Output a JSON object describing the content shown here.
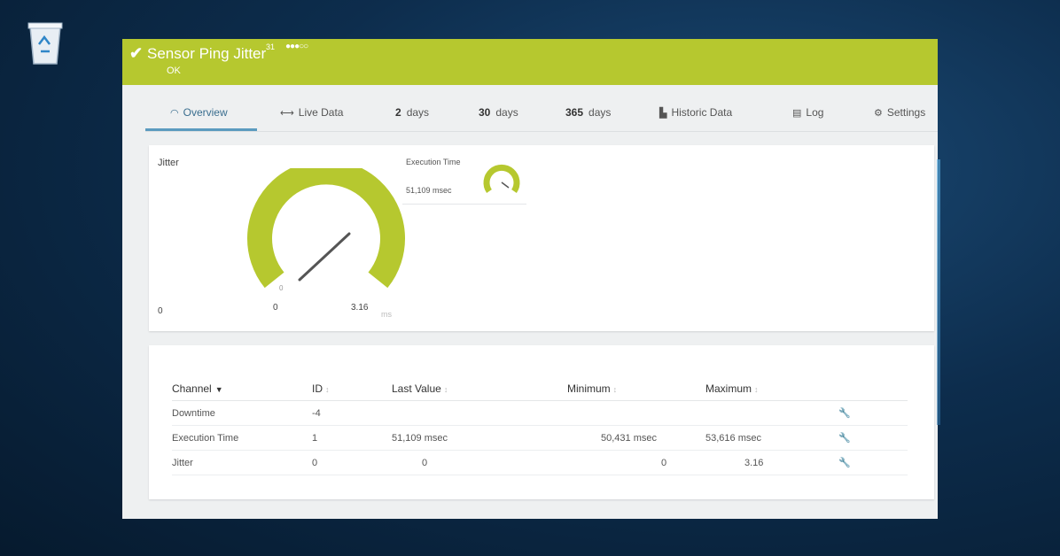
{
  "window": {
    "title": "Sensor Ping Jitter",
    "title_sup": "31",
    "priority_stars": "●●●○○",
    "status": "OK",
    "accent": "#b6c82f"
  },
  "tabs": [
    {
      "label": "Overview",
      "icon": "gauge-icon"
    },
    {
      "label": "Live Data",
      "icon": "live-data-icon"
    },
    {
      "num": "2",
      "label": "days"
    },
    {
      "num": "30",
      "label": "days"
    },
    {
      "num": "365",
      "label": "days"
    },
    {
      "label": "Historic Data",
      "icon": "chart-icon"
    },
    {
      "label": "Log",
      "icon": "log-icon"
    },
    {
      "label": "Settings",
      "icon": "gear-icon"
    }
  ],
  "gauges": {
    "jitter": {
      "label": "Jitter",
      "left_value": "0",
      "min_label": "0",
      "max_label": "3.16",
      "value": 0.85,
      "unit": "ms"
    },
    "execution": {
      "label": "Execution Time",
      "value_text": "51,109 msec",
      "value": 0.55
    }
  },
  "channels": {
    "headers": {
      "channel": "Channel",
      "id": "ID",
      "last": "Last Value",
      "min": "Minimum",
      "max": "Maximum"
    },
    "rows": [
      {
        "channel": "Downtime",
        "id": "-4",
        "last": "",
        "min": "",
        "max": ""
      },
      {
        "channel": "Execution Time",
        "id": "1",
        "last": "51,109 msec",
        "min": "50,431 msec",
        "max": "53,616 msec"
      },
      {
        "channel": "Jitter",
        "id": "0",
        "last": "0",
        "min": "0",
        "max": "3.16"
      }
    ]
  }
}
